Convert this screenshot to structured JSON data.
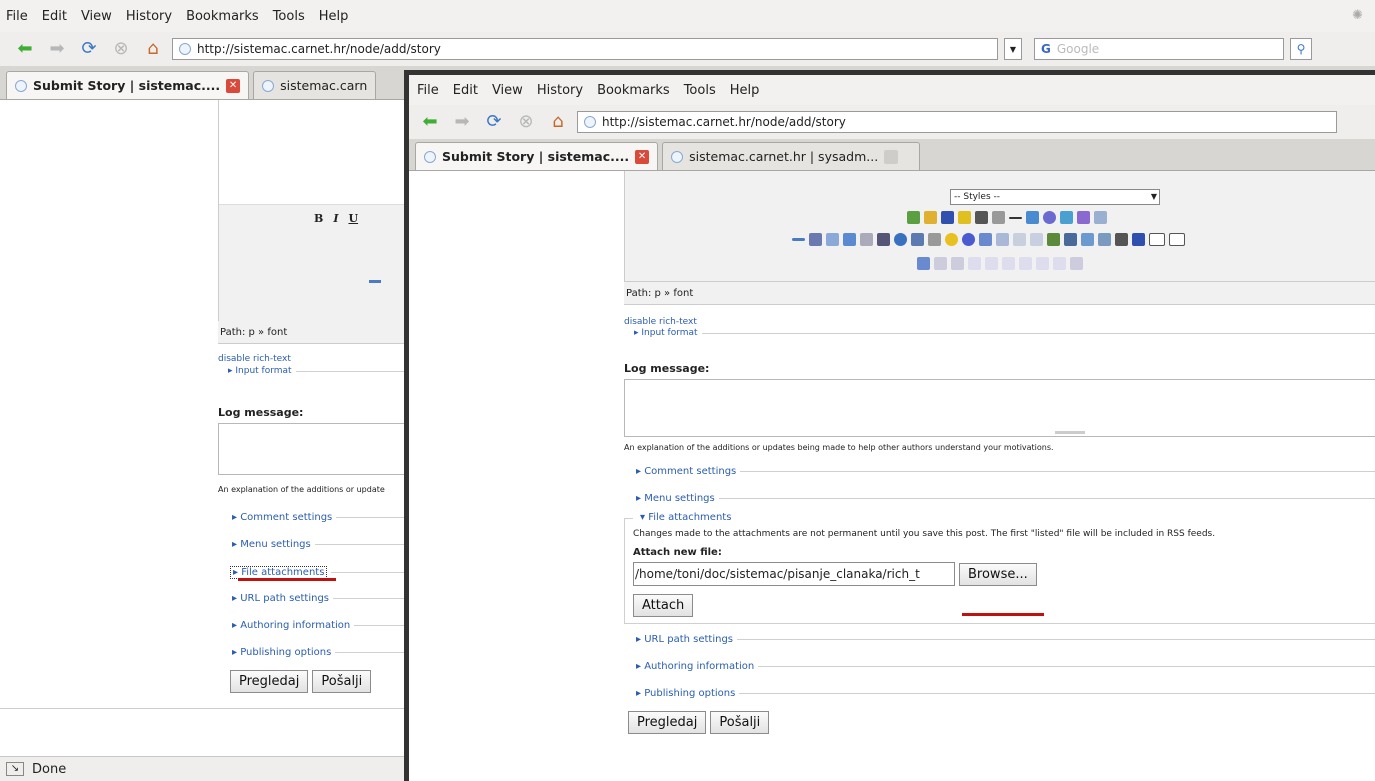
{
  "menu": [
    "File",
    "Edit",
    "View",
    "History",
    "Bookmarks",
    "Tools",
    "Help"
  ],
  "url": "http://sistemac.carnet.hr/node/add/story",
  "search_placeholder": "Google",
  "back_tabs": {
    "active": "Submit Story | sistemac....",
    "other": "sistemac.carn"
  },
  "front_tabs": {
    "active": "Submit Story | sistemac....",
    "other": "sistemac.carnet.hr | sysadm..."
  },
  "editor": {
    "styles_value": "-- Styles --",
    "path": "Path: p » font",
    "back_format_buttons": [
      "B",
      "I",
      "U"
    ]
  },
  "form": {
    "disable_rich": "disable rich-text",
    "input_format": "▸ Input format",
    "log_label": "Log message:",
    "log_help": "An explanation of the additions or updates being made to help other authors understand your motivations.",
    "log_help_truncated": "An explanation of the additions or update",
    "comment": "▸ Comment settings",
    "menu": "▸ Menu settings",
    "files_collapsed": "▸ File attachments",
    "files_expanded": "▾ File attachments",
    "files_note": "Changes made to the attachments are not permanent until you save this post. The first \"listed\" file will be included in RSS feeds.",
    "attach_label": "Attach new file:",
    "file_value": "/home/toni/doc/sistemac/pisanje_clanaka/rich_t",
    "browse": "Browse...",
    "attach": "Attach",
    "url_path": "▸ URL path settings",
    "authoring": "▸ Authoring information",
    "publishing": "▸ Publishing options",
    "preview": "Pregledaj",
    "submit": "Pošalji"
  },
  "status": "Done",
  "colors": {
    "link": "#2a5db0",
    "underline": "#c01010",
    "frame": "#333333"
  }
}
